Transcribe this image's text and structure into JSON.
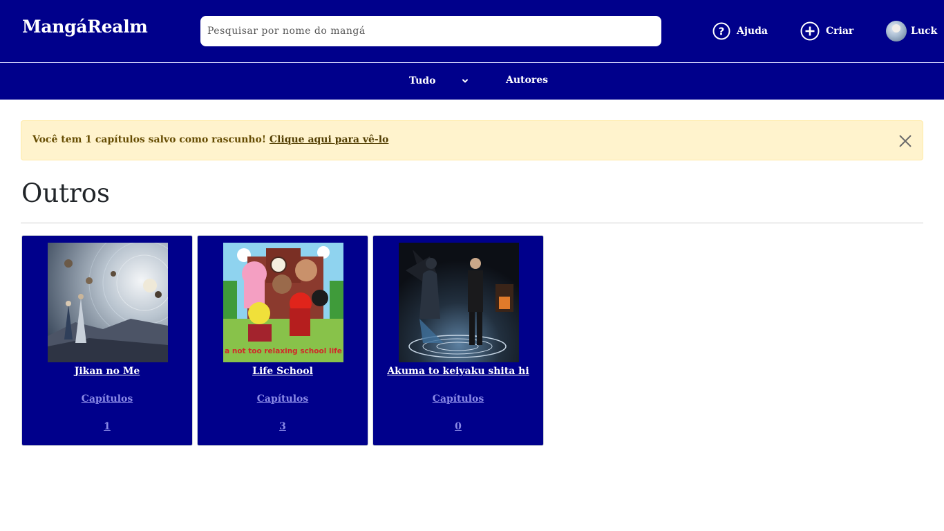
{
  "header": {
    "brand": "MangáRealm",
    "search_placeholder": "Pesquisar por nome do mangá",
    "help_label": "Ajuda",
    "create_label": "Criar",
    "user_name": "Luck"
  },
  "subnav": {
    "all_label": "Tudo",
    "authors_label": "Autores"
  },
  "alert": {
    "message": "Você tem 1 capítulos salvo como rascunho!",
    "link_text": "Clique aqui para vê-lo"
  },
  "section": {
    "title": "Outros"
  },
  "cards": [
    {
      "title": "Jikan no Me",
      "chapters_label": "Capítulos",
      "chapters_count": "1"
    },
    {
      "title": "Life School",
      "chapters_label": "Capítulos",
      "chapters_count": "3",
      "cover_caption": "a not too relaxing school life"
    },
    {
      "title": "Akuma to keiyaku shita hi",
      "chapters_label": "Capítulos",
      "chapters_count": "0"
    }
  ],
  "colors": {
    "primary": "#00008b",
    "alert_bg": "#fff3cd",
    "alert_text": "#664d03",
    "link_muted": "#8a8ae6"
  },
  "icons": [
    "help-circle-icon",
    "plus-circle-icon",
    "chevron-down-icon",
    "close-icon"
  ]
}
